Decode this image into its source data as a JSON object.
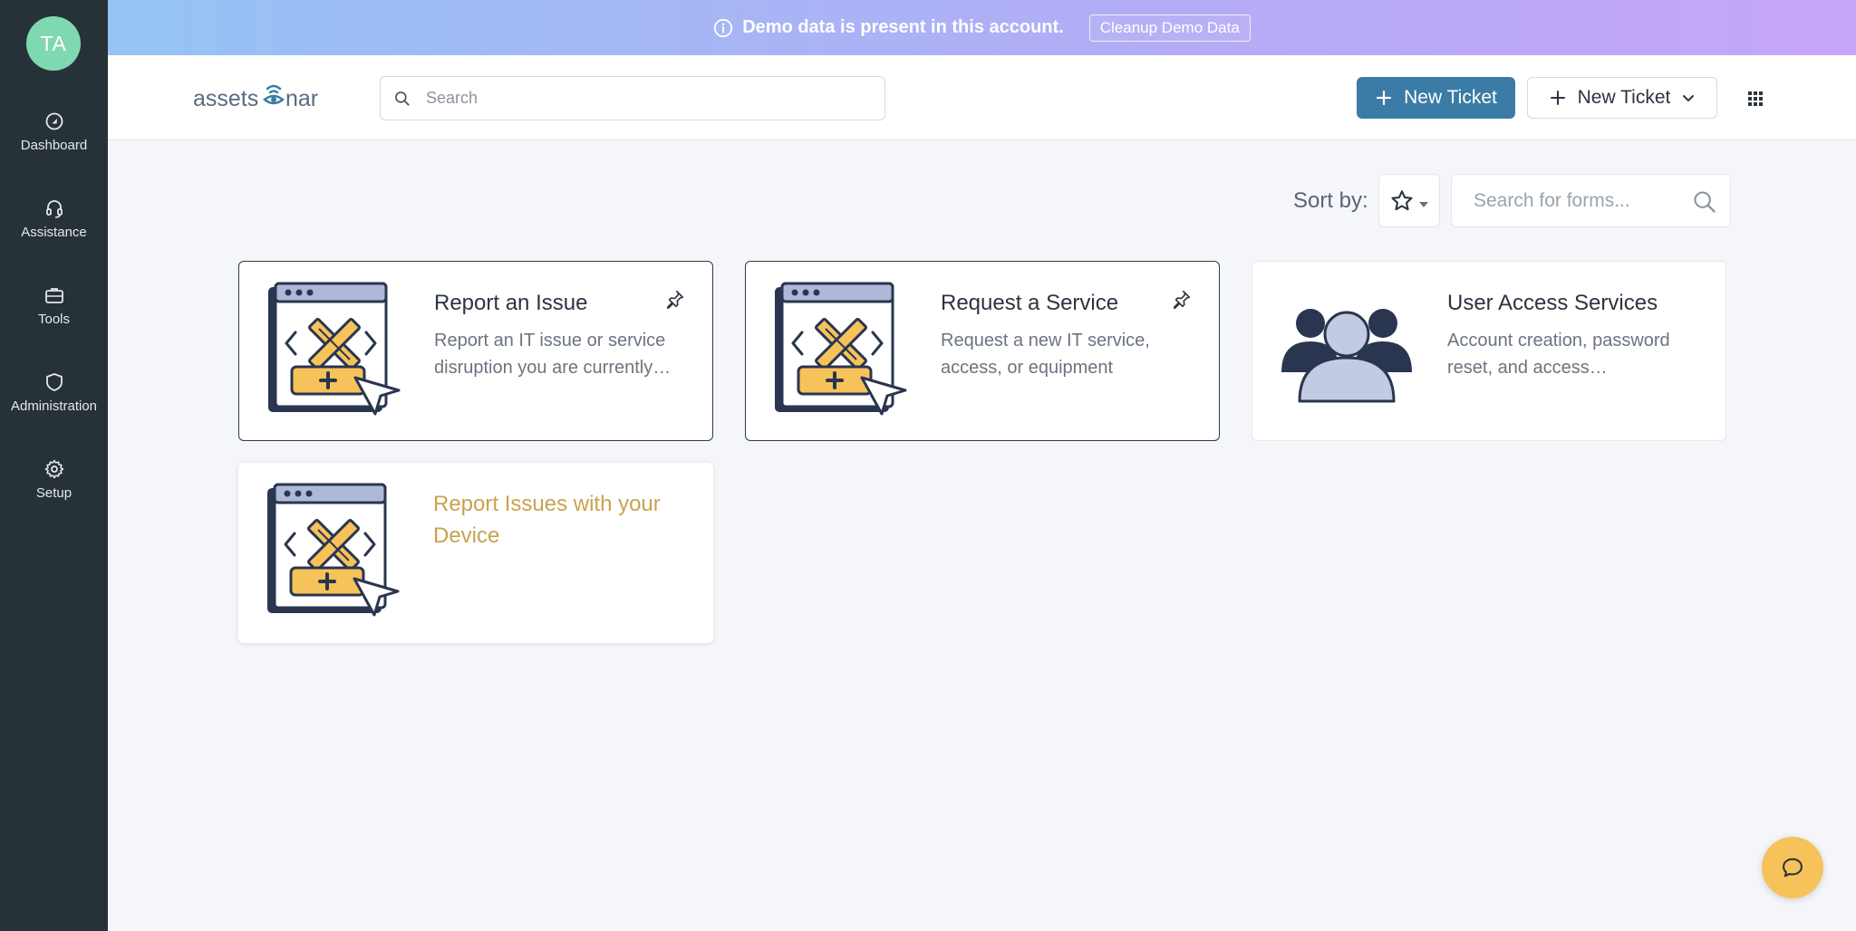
{
  "sidebar": {
    "avatar_initials": "TA",
    "items": [
      {
        "label": "Dashboard",
        "icon": "dashboard-icon"
      },
      {
        "label": "Assistance",
        "icon": "headset-icon"
      },
      {
        "label": "Tools",
        "icon": "briefcase-icon"
      },
      {
        "label": "Administration",
        "icon": "shield-icon"
      },
      {
        "label": "Setup",
        "icon": "gear-icon"
      }
    ]
  },
  "banner": {
    "message": "Demo data is present in this account.",
    "button_label": "Cleanup Demo Data"
  },
  "header": {
    "logo_text_left": "assets",
    "logo_text_right": "nar",
    "search_placeholder": "Search",
    "new_ticket_primary": "New Ticket",
    "new_ticket_secondary": "New Ticket"
  },
  "forms_toolbar": {
    "sort_label": "Sort by:",
    "search_placeholder": "Search for forms..."
  },
  "cards": [
    {
      "title": "Report an Issue",
      "description": "Report an IT issue or service disruption you are currently…",
      "pinned": true
    },
    {
      "title": "Request a Service",
      "description": "Request a new IT service, access, or equipment",
      "pinned": true
    },
    {
      "title": "User Access Services",
      "description": "Account creation, password reset, and access…",
      "pinned": false
    },
    {
      "title": "Report Issues with your Device",
      "description": "",
      "pinned": false
    }
  ],
  "colors": {
    "sidebar_bg": "#263238",
    "primary": "#3a7ca5",
    "accent_gold": "#c9a24e",
    "avatar_bg": "#7fd9b0",
    "chat_bg": "#f6c25a"
  }
}
